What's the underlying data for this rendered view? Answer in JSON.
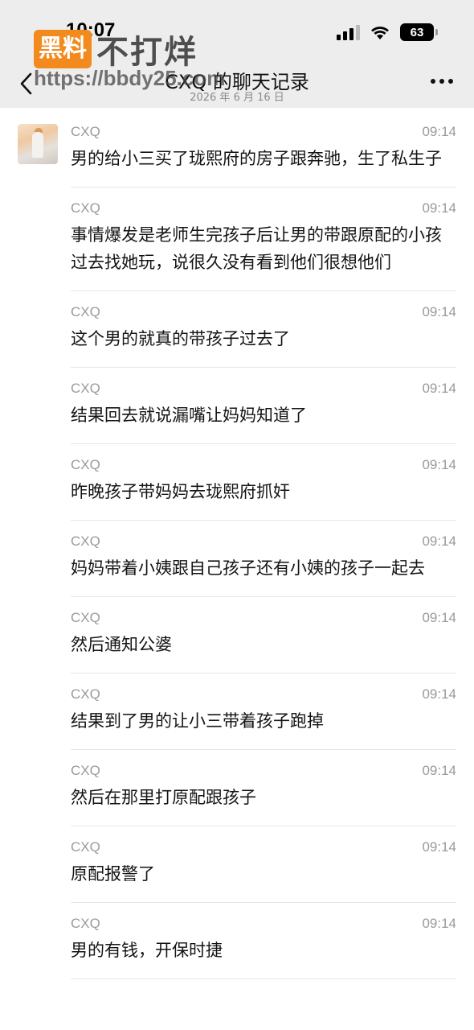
{
  "status_bar": {
    "time": "10:07",
    "battery": "63"
  },
  "watermark": {
    "badge": "黑料",
    "text": "不打烊",
    "url": "https://bbdy25.com"
  },
  "nav": {
    "title": "CXQ 的聊天记录",
    "subtitle": "2026 年 6 月 16 日"
  },
  "messages": [
    {
      "name": "CXQ",
      "time": "09:14",
      "text": "男的给小三买了珑熙府的房子跟奔驰，生了私生子"
    },
    {
      "name": "CXQ",
      "time": "09:14",
      "text": "事情爆发是老师生完孩子后让男的带跟原配的小孩过去找她玩，说很久没有看到他们很想他们"
    },
    {
      "name": "CXQ",
      "time": "09:14",
      "text": "这个男的就真的带孩子过去了"
    },
    {
      "name": "CXQ",
      "time": "09:14",
      "text": "结果回去就说漏嘴让妈妈知道了"
    },
    {
      "name": "CXQ",
      "time": "09:14",
      "text": "昨晚孩子带妈妈去珑熙府抓奸"
    },
    {
      "name": "CXQ",
      "time": "09:14",
      "text": "妈妈带着小姨跟自己孩子还有小姨的孩子一起去"
    },
    {
      "name": "CXQ",
      "time": "09:14",
      "text": "然后通知公婆"
    },
    {
      "name": "CXQ",
      "time": "09:14",
      "text": "结果到了男的让小三带着孩子跑掉"
    },
    {
      "name": "CXQ",
      "time": "09:14",
      "text": "然后在那里打原配跟孩子"
    },
    {
      "name": "CXQ",
      "time": "09:14",
      "text": "原配报警了"
    },
    {
      "name": "CXQ",
      "time": "09:14",
      "text": "男的有钱，开保时捷"
    }
  ]
}
